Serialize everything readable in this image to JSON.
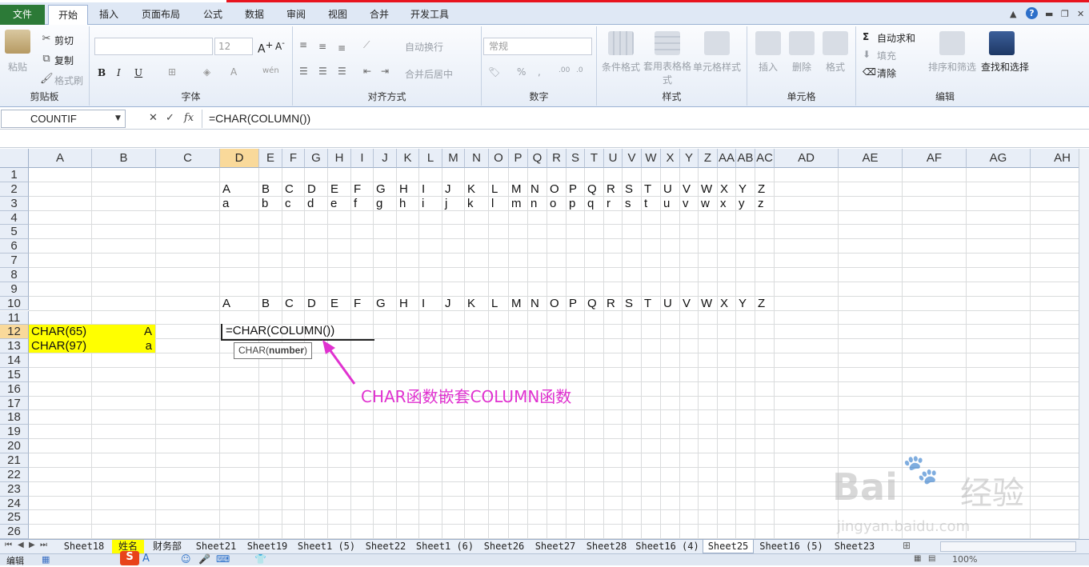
{
  "ribbon_tabs": [
    "文件",
    "开始",
    "插入",
    "页面布局",
    "公式",
    "数据",
    "审阅",
    "视图",
    "合并",
    "开发工具"
  ],
  "clipboard": {
    "paste": "粘贴",
    "cut": "剪切",
    "copy": "复制",
    "format_painter": "格式刷",
    "label": "剪贴板"
  },
  "font": {
    "label": "字体",
    "size": "12"
  },
  "align": {
    "wrap": "自动换行",
    "merge": "合并后居中",
    "label": "对齐方式"
  },
  "number": {
    "format": "常规",
    "label": "数字"
  },
  "styles": {
    "cond": "条件格式",
    "table": "套用表格格式",
    "cell": "单元格样式",
    "label": "样式"
  },
  "cells": {
    "insert": "插入",
    "delete": "删除",
    "format": "格式",
    "label": "单元格"
  },
  "editing": {
    "autosum": "自动求和",
    "fill": "填充",
    "clear": "清除",
    "sort": "排序和筛选",
    "find": "查找和选择",
    "label": "编辑"
  },
  "formula_bar": {
    "name_box": "COUNTIF",
    "formula": "=CHAR(COLUMN())"
  },
  "columns": [
    "A",
    "B",
    "C",
    "D",
    "E",
    "F",
    "G",
    "H",
    "I",
    "J",
    "K",
    "L",
    "M",
    "N",
    "O",
    "P",
    "Q",
    "R",
    "S",
    "T",
    "U",
    "V",
    "W",
    "X",
    "Y",
    "Z",
    "AA",
    "AB",
    "AC",
    "AD",
    "AE",
    "AF",
    "AG",
    "AH"
  ],
  "rows": [
    "1",
    "2",
    "3",
    "4",
    "5",
    "6",
    "7",
    "8",
    "9",
    "10",
    "11",
    "12",
    "13",
    "14",
    "15",
    "16",
    "17",
    "18",
    "19",
    "20",
    "21",
    "22",
    "23",
    "24",
    "25",
    "26"
  ],
  "row2": [
    "A",
    "B",
    "C",
    "D",
    "E",
    "F",
    "G",
    "H",
    "I",
    "J",
    "K",
    "L",
    "M",
    "N",
    "O",
    "P",
    "Q",
    "R",
    "S",
    "T",
    "U",
    "V",
    "W",
    "X",
    "Y",
    "Z"
  ],
  "row3": [
    "a",
    "b",
    "c",
    "d",
    "e",
    "f",
    "g",
    "h",
    "i",
    "j",
    "k",
    "l",
    "m",
    "n",
    "o",
    "p",
    "q",
    "r",
    "s",
    "t",
    "u",
    "v",
    "w",
    "x",
    "y",
    "z"
  ],
  "row10": [
    "A",
    "B",
    "C",
    "D",
    "E",
    "F",
    "G",
    "H",
    "I",
    "J",
    "K",
    "L",
    "M",
    "N",
    "O",
    "P",
    "Q",
    "R",
    "S",
    "T",
    "U",
    "V",
    "W",
    "X",
    "Y",
    "Z"
  ],
  "cell_a12": "CHAR(65)",
  "cell_b12": "A",
  "cell_a13": "CHAR(97)",
  "cell_b13": "a",
  "edit_text": "=CHAR(COLUMN())",
  "tooltip": {
    "fn": "CHAR(",
    "arg": "number",
    ")": ")"
  },
  "annotation": "CHAR函数嵌套COLUMN函数",
  "sheets": [
    "Sheet18",
    "姓名",
    "财务部",
    "Sheet21",
    "Sheet19",
    "Sheet1 (5)",
    "Sheet22",
    "Sheet1 (6)",
    "Sheet26",
    "Sheet27",
    "Sheet28",
    "Sheet16 (4)",
    "Sheet25",
    "Sheet16 (5)",
    "Sheet23"
  ],
  "active_sheet": "Sheet25",
  "status": {
    "mode": "编辑",
    "zoom": "100%"
  },
  "watermark": {
    "brand": "Bai",
    "brand2": "经验",
    "url": "jingyan.baidu.com"
  },
  "colors": {
    "highlight": "#ffff00",
    "annotation": "#e032d0",
    "file_tab": "#2c7a37"
  }
}
